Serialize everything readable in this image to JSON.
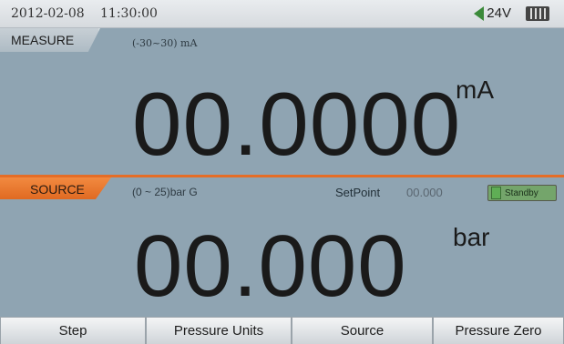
{
  "status": {
    "date": "2012-02-08",
    "time": "11:30:00",
    "voltage": "24V",
    "power_icon": "plug-icon",
    "battery_icon": "battery-icon"
  },
  "measure": {
    "label": "MEASURE",
    "range": "(-30~30) mA",
    "value": "00.0000",
    "unit": "mA"
  },
  "source": {
    "label": "SOURCE",
    "range": "(0 ~ 25)bar G",
    "setpoint_label": "SetPoint",
    "setpoint_value": "00.000",
    "standby_label": "Standby",
    "value": "00.000",
    "unit": "bar"
  },
  "softkeys": [
    {
      "label": "Step"
    },
    {
      "label": "Pressure Units"
    },
    {
      "label": "Source"
    },
    {
      "label": "Pressure Zero"
    }
  ],
  "colors": {
    "background": "#8fa4b2",
    "source_accent": "#e56d26",
    "standby_green": "#74a56b"
  }
}
